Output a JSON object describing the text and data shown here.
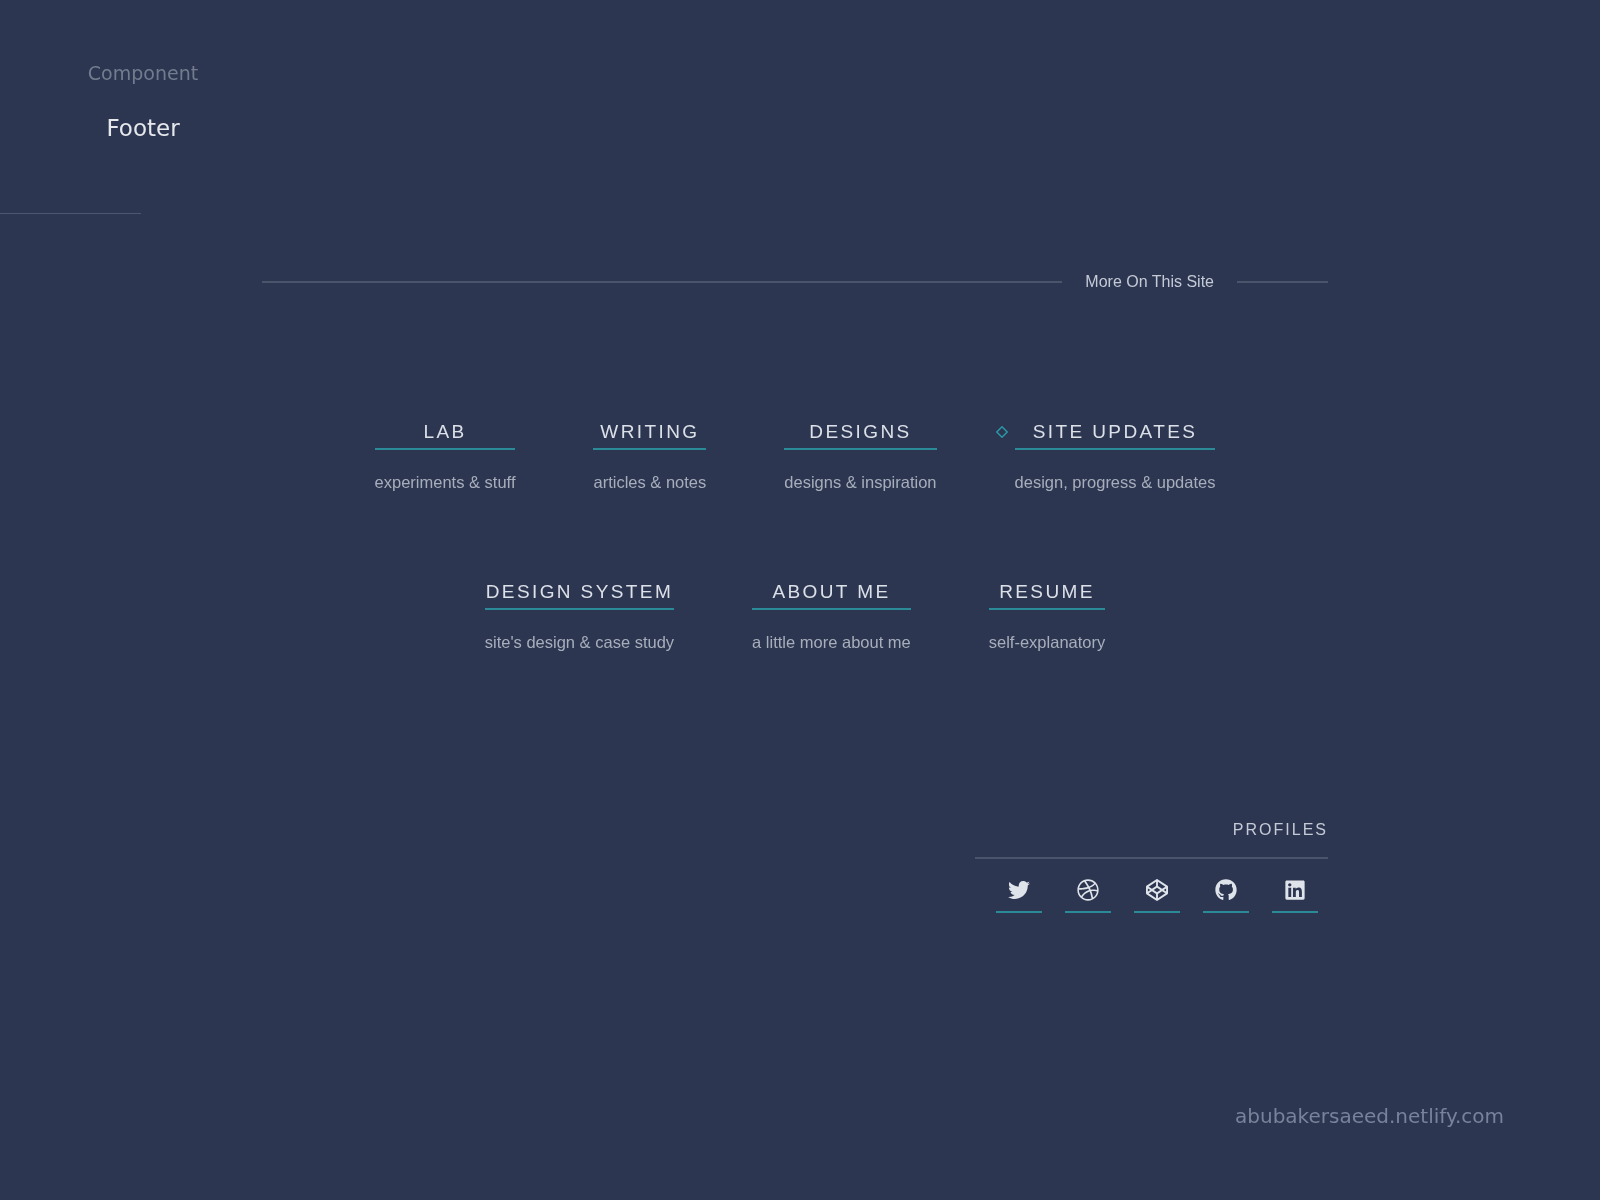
{
  "presentation": {
    "label": "Component",
    "title": "Footer",
    "credit": "abubakersaeed.netlify.com"
  },
  "footer": {
    "heading": "More On This Site",
    "nav_rows": [
      {
        "items": [
          {
            "title": "LAB",
            "description": "experiments & stuff",
            "new": false
          },
          {
            "title": "WRITING",
            "description": "articles & notes",
            "new": false
          },
          {
            "title": "DESIGNS",
            "description": "designs & inspiration",
            "new": false
          },
          {
            "title": "SITE UPDATES",
            "description": "design, progress & updates",
            "new": true
          }
        ]
      },
      {
        "items": [
          {
            "title": "DESIGN SYSTEM",
            "description": "site's design & case study",
            "new": false
          },
          {
            "title": "ABOUT ME",
            "description": "a little more about me",
            "new": false
          },
          {
            "title": "RESUME",
            "description": "self-explanatory",
            "new": false
          }
        ]
      }
    ],
    "profiles": {
      "heading": "PROFILES",
      "links": [
        {
          "kind": "twitter"
        },
        {
          "kind": "dribbble"
        },
        {
          "kind": "codepen"
        },
        {
          "kind": "github"
        },
        {
          "kind": "linkedin"
        }
      ]
    }
  }
}
